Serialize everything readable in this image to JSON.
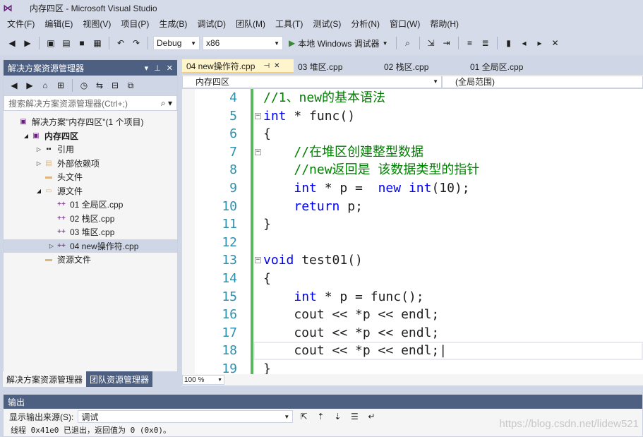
{
  "window": {
    "title": "内存四区 - Microsoft Visual Studio"
  },
  "menu": [
    "文件(F)",
    "编辑(E)",
    "视图(V)",
    "项目(P)",
    "生成(B)",
    "调试(D)",
    "团队(M)",
    "工具(T)",
    "测试(S)",
    "分析(N)",
    "窗口(W)",
    "帮助(H)"
  ],
  "toolbar": {
    "config": "Debug",
    "platform": "x86",
    "run_label": "本地 Windows 调试器"
  },
  "solution_explorer": {
    "title": "解决方案资源管理器",
    "search_placeholder": "搜索解决方案资源管理器(Ctrl+;)",
    "tree": [
      {
        "label": "解决方案\"内存四区\"(1 个项目)",
        "indent": 0,
        "icon": "solution-icon",
        "exp": ""
      },
      {
        "label": "内存四区",
        "indent": 1,
        "icon": "project-icon",
        "exp": "◢",
        "bold": true
      },
      {
        "label": "引用",
        "indent": 2,
        "icon": "references-icon",
        "exp": "▷"
      },
      {
        "label": "外部依赖项",
        "indent": 2,
        "icon": "external-deps-icon",
        "exp": "▷"
      },
      {
        "label": "头文件",
        "indent": 2,
        "icon": "folder-icon",
        "exp": ""
      },
      {
        "label": "源文件",
        "indent": 2,
        "icon": "folder-open-icon",
        "exp": "◢"
      },
      {
        "label": "01 全局区.cpp",
        "indent": 3,
        "icon": "cpp-file-icon",
        "exp": ""
      },
      {
        "label": "02 栈区.cpp",
        "indent": 3,
        "icon": "cpp-file-icon",
        "exp": ""
      },
      {
        "label": "03 堆区.cpp",
        "indent": 3,
        "icon": "cpp-file-icon",
        "exp": ""
      },
      {
        "label": "04 new操作符.cpp",
        "indent": 3,
        "icon": "cpp-file-icon",
        "exp": "▷",
        "selected": true
      },
      {
        "label": "资源文件",
        "indent": 2,
        "icon": "folder-icon",
        "exp": ""
      }
    ],
    "bottom_tabs": [
      "解决方案资源管理器",
      "团队资源管理器"
    ]
  },
  "editor": {
    "tabs": [
      {
        "label": "04 new操作符.cpp",
        "active": true
      },
      {
        "label": "03 堆区.cpp",
        "active": false
      },
      {
        "label": "02 栈区.cpp",
        "active": false
      },
      {
        "label": "01 全局区.cpp",
        "active": false
      }
    ],
    "nav_project": "内存四区",
    "nav_scope": "(全局范围)",
    "zoom": "100 %",
    "lines": [
      {
        "num": "4",
        "fold": "",
        "html": "<span class=\"cm\">//1、new的基本语法</span>"
      },
      {
        "num": "5",
        "fold": "⊟",
        "html": "<span class=\"kw\">int</span> * func()"
      },
      {
        "num": "6",
        "fold": "",
        "html": "{"
      },
      {
        "num": "7",
        "fold": "⊟",
        "html": "    <span class=\"cm\">//在堆区创建整型数据</span>"
      },
      {
        "num": "8",
        "fold": "",
        "html": "    <span class=\"cm\">//new返回是 该数据类型的指针</span>"
      },
      {
        "num": "9",
        "fold": "",
        "html": "    <span class=\"kw\">int</span> * p =  <span class=\"kw\">new</span> <span class=\"kw\">int</span>(10);"
      },
      {
        "num": "10",
        "fold": "",
        "html": "    <span class=\"kw\">return</span> p;"
      },
      {
        "num": "11",
        "fold": "",
        "html": "}"
      },
      {
        "num": "12",
        "fold": "",
        "html": ""
      },
      {
        "num": "13",
        "fold": "⊟",
        "html": "<span class=\"kw\">void</span> test01()"
      },
      {
        "num": "14",
        "fold": "",
        "html": "{"
      },
      {
        "num": "15",
        "fold": "",
        "html": "    <span class=\"kw\">int</span> * p = func();"
      },
      {
        "num": "16",
        "fold": "",
        "html": "    cout &lt;&lt; *p &lt;&lt; endl;"
      },
      {
        "num": "17",
        "fold": "",
        "html": "    cout &lt;&lt; *p &lt;&lt; endl;"
      },
      {
        "num": "18",
        "fold": "",
        "html": "    cout &lt;&lt; *p &lt;&lt; endl;|",
        "current": true
      },
      {
        "num": "19",
        "fold": "",
        "html": "}"
      }
    ]
  },
  "output": {
    "title": "输出",
    "source_label": "显示输出来源(S):",
    "source_value": "调试",
    "text": "线程 0x41e0 已退出，返回值为 0 (0x0)。"
  },
  "watermark": "https://blog.csdn.net/lidew521"
}
